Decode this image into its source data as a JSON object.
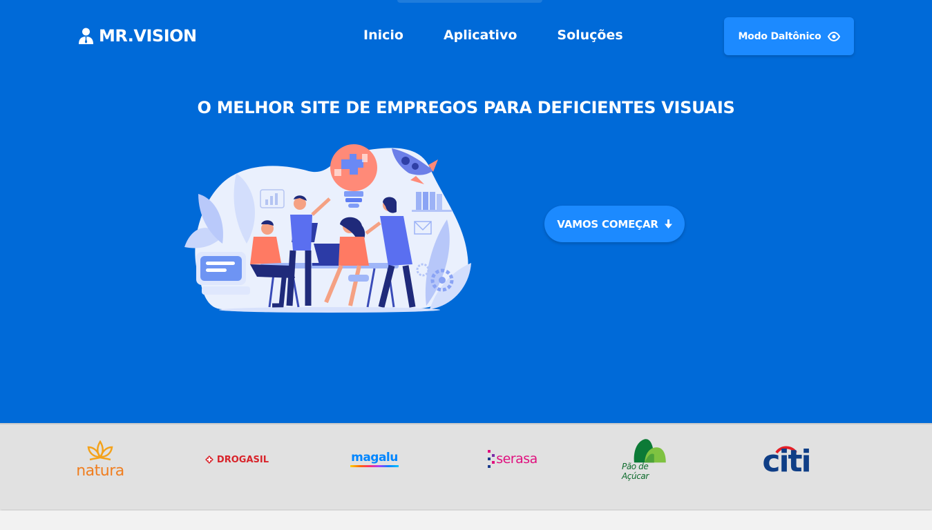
{
  "brand": {
    "name": "MR.VISION",
    "icon": "user-tie-icon"
  },
  "nav": {
    "items": [
      {
        "label": "Inicio"
      },
      {
        "label": "Aplicativo"
      },
      {
        "label": "Soluções"
      }
    ]
  },
  "daltonic": {
    "label": "Modo Daltônico",
    "icon": "eye-icon"
  },
  "hero": {
    "headline": "O MELHOR SITE DE EMPREGOS PARA DEFICIENTES VISUAIS",
    "illustration": "team-working-illustration",
    "cta_label": "VAMOS COMEÇAR",
    "cta_icon": "arrow-down-icon"
  },
  "partners": {
    "logos": [
      {
        "name": "natura",
        "text": "natura"
      },
      {
        "name": "drogasil",
        "text": "DROGASIL"
      },
      {
        "name": "magalu",
        "text": "magalu"
      },
      {
        "name": "serasa",
        "text": "serasa"
      },
      {
        "name": "pao-de-acucar",
        "text": "Pão de Açúcar"
      },
      {
        "name": "citi",
        "text": "citi"
      }
    ]
  },
  "colors": {
    "hero_bg": "#006ad8",
    "button_bg": "#1c8aff",
    "partners_bg": "#e1e1e1",
    "page_bg": "#f2f2f2"
  }
}
